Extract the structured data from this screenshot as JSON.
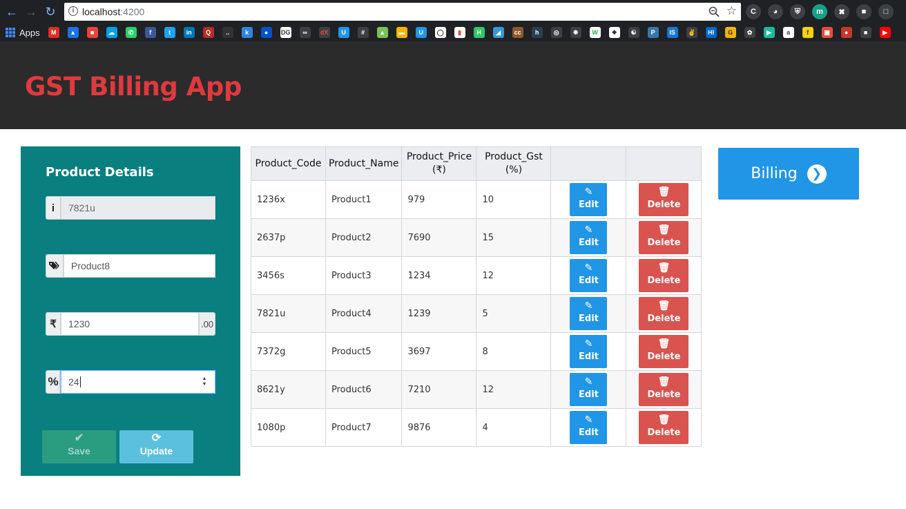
{
  "browser": {
    "url_host": "localhost",
    "url_port": ":4200",
    "bookmarks_apps_label": "Apps"
  },
  "app": {
    "title": "GST Billing App"
  },
  "form": {
    "title": "Product Details",
    "code_value": "7821u",
    "name_value": "Product8",
    "price_value": "1230",
    "price_suffix": ".00",
    "gst_value": "24",
    "save_label": "Save",
    "update_label": "Update",
    "icons": {
      "code": "info-icon",
      "name": "tags-icon",
      "price": "rupee-icon",
      "gst": "percent-icon",
      "save": "check-icon",
      "update": "refresh-icon"
    }
  },
  "table": {
    "headers": [
      "Product_Code",
      "Product_Name",
      "Product_Price (₹)",
      "Product_Gst (%)",
      "",
      ""
    ],
    "header_price_line1": "Product_Price",
    "header_price_line2": "(₹)",
    "header_gst_line1": "Product_Gst",
    "header_gst_line2": "(%)",
    "edit_label": "Edit",
    "delete_label": "Delete",
    "rows": [
      {
        "code": "1236x",
        "name": "Product1",
        "price": "979",
        "gst": "10"
      },
      {
        "code": "2637p",
        "name": "Product2",
        "price": "7690",
        "gst": "15"
      },
      {
        "code": "3456s",
        "name": "Product3",
        "price": "1234",
        "gst": "12"
      },
      {
        "code": "7821u",
        "name": "Product4",
        "price": "1239",
        "gst": "5"
      },
      {
        "code": "7372g",
        "name": "Product5",
        "price": "3697",
        "gst": "8"
      },
      {
        "code": "8621y",
        "name": "Product6",
        "price": "7210",
        "gst": "12"
      },
      {
        "code": "1080p",
        "name": "Product7",
        "price": "9876",
        "gst": "4"
      }
    ]
  },
  "billing": {
    "label": "Billing",
    "icon": "chevron-circle-right-icon"
  },
  "colors": {
    "header_bg": "#2b2b2b",
    "title_red": "#e0393e",
    "panel_teal": "#0a7f7f",
    "edit_blue": "#2196e6",
    "delete_red": "#d9534f",
    "update_cyan": "#5bc0de",
    "save_green": "#2a9d81"
  }
}
